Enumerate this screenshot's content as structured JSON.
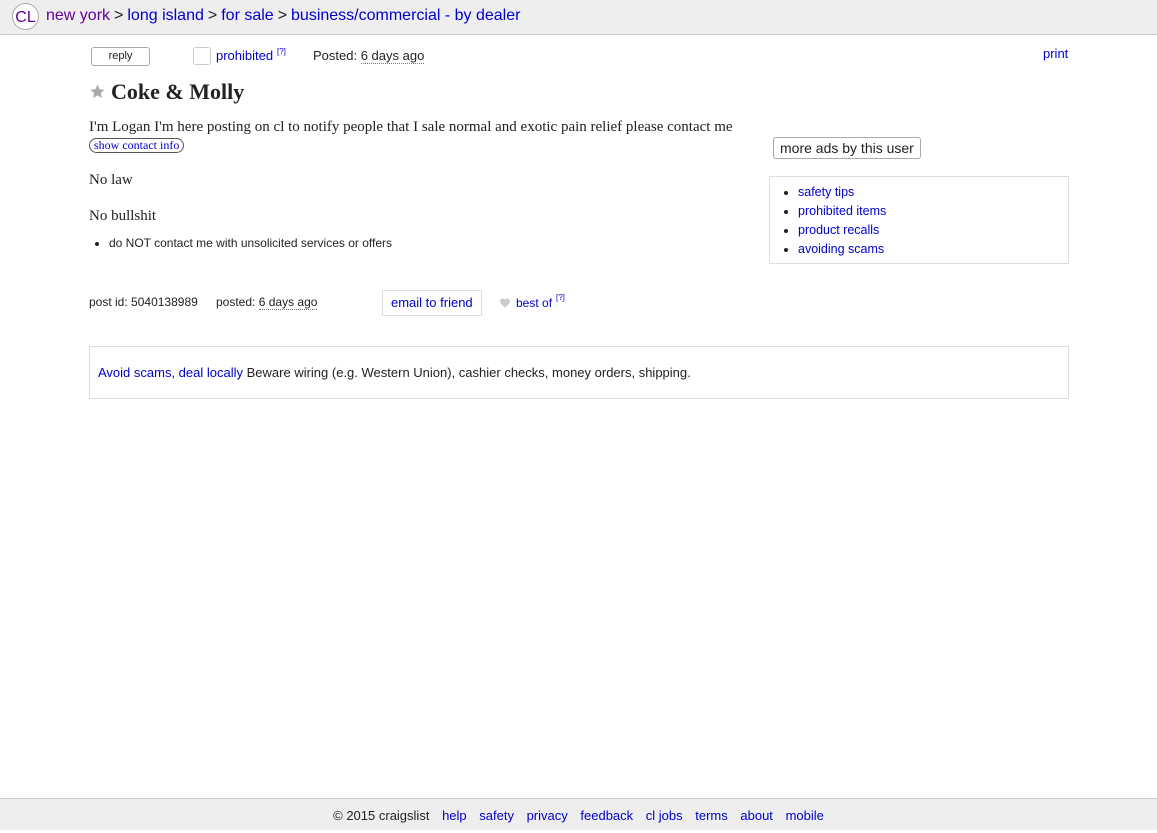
{
  "header": {
    "logo_text": "CL",
    "breadcrumbs": [
      "new york",
      "long island",
      "for sale",
      "business/commercial - by dealer"
    ],
    "separator": ">"
  },
  "toolbar": {
    "reply_label": "reply",
    "prohibited_label": "prohibited",
    "help_mark": "[?]",
    "posted_label": "Posted:",
    "posted_value": "6 days ago",
    "print_label": "print"
  },
  "post": {
    "title": "Coke & Molly",
    "body": "I'm Logan I'm here posting on cl to notify people that I sale normal and exotic pain relief please contact me",
    "show_contact_label": "show contact info",
    "line_1": "No law",
    "line_2": "No bullshit",
    "notices": [
      "do NOT contact me with unsolicited services or offers"
    ]
  },
  "sidebar": {
    "more_ads_label": "more ads by this user",
    "safety_links": [
      "safety tips",
      "prohibited items",
      "product recalls",
      "avoiding scams"
    ]
  },
  "meta": {
    "post_id_label": "post id:",
    "post_id": "5040138989",
    "posted_label": "posted:",
    "posted_value": "6 days ago",
    "email_label": "email to friend",
    "best_of_label": "best of",
    "help_mark": "[?]"
  },
  "scam_notice": {
    "link": "Avoid scams, deal locally",
    "text": "Beware wiring (e.g. Western Union), cashier checks, money orders, shipping."
  },
  "footer": {
    "copyright": "© 2015 craigslist",
    "links": [
      "help",
      "safety",
      "privacy",
      "feedback",
      "cl jobs",
      "terms",
      "about",
      "mobile"
    ]
  },
  "colors": {
    "link": "#0000cc",
    "visited": "#660099",
    "bar": "#eeeeee"
  }
}
